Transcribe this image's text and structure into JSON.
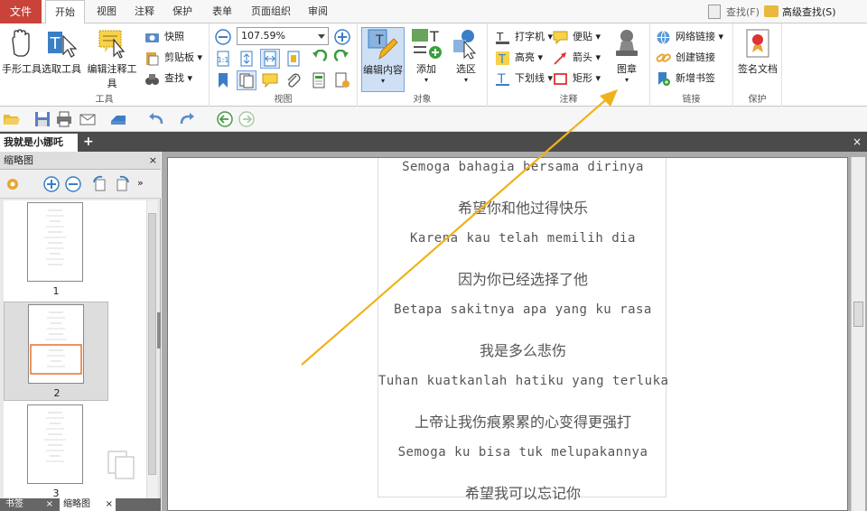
{
  "menubar": {
    "file": "文件",
    "tabs": [
      "开始",
      "视图",
      "注释",
      "保护",
      "表单",
      "页面组织",
      "审阅"
    ],
    "find": "查找(F)",
    "advanced_find": "高级查找(S)"
  },
  "ribbon": {
    "tools": {
      "hand": "手形工具",
      "select": "选取工具",
      "edit_annot": "编辑注释工具",
      "snapshot": "快照",
      "clipboard": "剪贴板",
      "find": "查找",
      "group": "工具"
    },
    "view": {
      "zoom": "107.59%",
      "group": "视图"
    },
    "object": {
      "edit_content": "编辑内容",
      "add": "添加",
      "select_area": "选区",
      "group": "对象"
    },
    "annot": {
      "typewriter": "打字机",
      "note": "便贴",
      "highlight": "高亮",
      "arrow": "箭头",
      "underline": "下划线",
      "rect": "矩形",
      "stamp": "图章",
      "group": "注释"
    },
    "link": {
      "web_link": "网络链接",
      "create_link": "创建链接",
      "new_bookmark": "新增书签",
      "group": "链接"
    },
    "protect": {
      "sign": "签名文档",
      "group": "保护"
    }
  },
  "doc_tab": "我就是小娜吒",
  "left_panel": {
    "title": "缩略图",
    "pages": [
      "1",
      "2",
      "3"
    ],
    "bottom_tabs": [
      "书签",
      "缩略图"
    ]
  },
  "document": {
    "lines": [
      {
        "text": "Semoga bahagia bersama dirinya",
        "kind": "latin"
      },
      {
        "text": "希望你和他过得快乐",
        "kind": "cjk"
      },
      {
        "text": "Karena kau telah memilih dia",
        "kind": "latin"
      },
      {
        "text": "因为你已经选择了他",
        "kind": "cjk"
      },
      {
        "text": "Betapa sakitnya apa yang ku rasa",
        "kind": "latin"
      },
      {
        "text": "我是多么悲伤",
        "kind": "cjk"
      },
      {
        "text": "Tuhan kuatkanlah hatiku yang terluka",
        "kind": "latin"
      },
      {
        "text": "上帝让我伤痕累累的心变得更强打",
        "kind": "cjk"
      },
      {
        "text": "Semoga ku bisa tuk melupakannya",
        "kind": "latin"
      },
      {
        "text": "希望我可以忘记你",
        "kind": "cjk"
      }
    ]
  },
  "colors": {
    "file_menu": "#c9433a",
    "annotation_arrow": "#f0b21a"
  }
}
